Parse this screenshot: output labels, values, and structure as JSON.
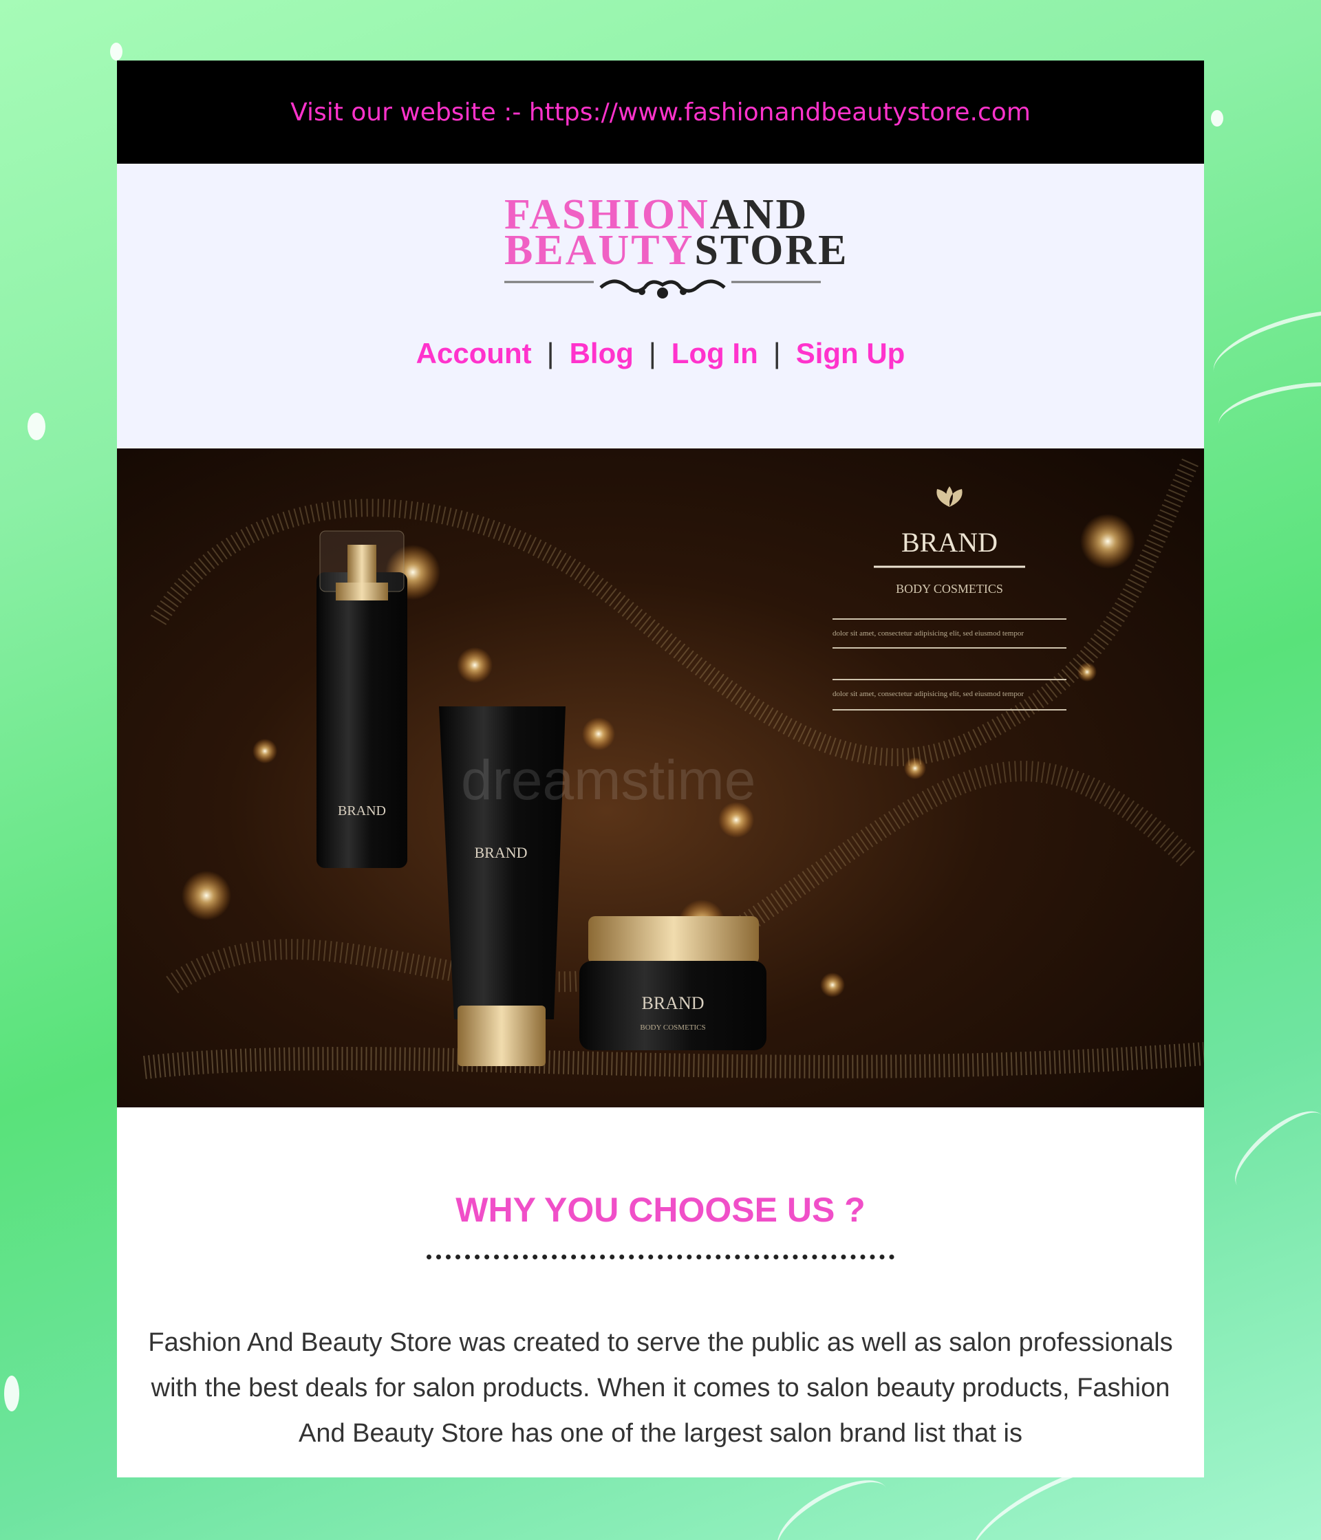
{
  "topbar": {
    "text": "Visit our website :- https://www.fashionandbeautystore.com"
  },
  "logo": {
    "line1_pink": "FASHION",
    "line1_dark": "AND",
    "line2_pink": "BEAUTY",
    "line2_dark": "STORE"
  },
  "nav": {
    "items": [
      "Account",
      "Blog",
      "Log In",
      "Sign Up"
    ],
    "separator": "|"
  },
  "hero": {
    "brand": "BRAND",
    "subtitle": "BODY COSMETICS",
    "lorem_line_1": "dolor sit amet, consectetur adipisicing elit, sed eiusmod tempor",
    "lorem_line_2": "dolor sit amet, consectetur adipisicing elit, sed eiusmod tempor",
    "product_label_brand": "BRAND",
    "product_label_sub": "BODY COSMETICS",
    "watermark": "dreamstime"
  },
  "why": {
    "title": "WHY YOU CHOOSE US ?",
    "paragraph": "Fashion And Beauty Store was created to serve the public as well as salon professionals with the best deals for salon products. When it comes to salon beauty products, Fashion And Beauty Store has one of the largest salon brand list that is"
  },
  "colors": {
    "accent_pink": "#ff33cc",
    "topbar_bg": "#000000",
    "header_bg": "#f2f3ff"
  }
}
